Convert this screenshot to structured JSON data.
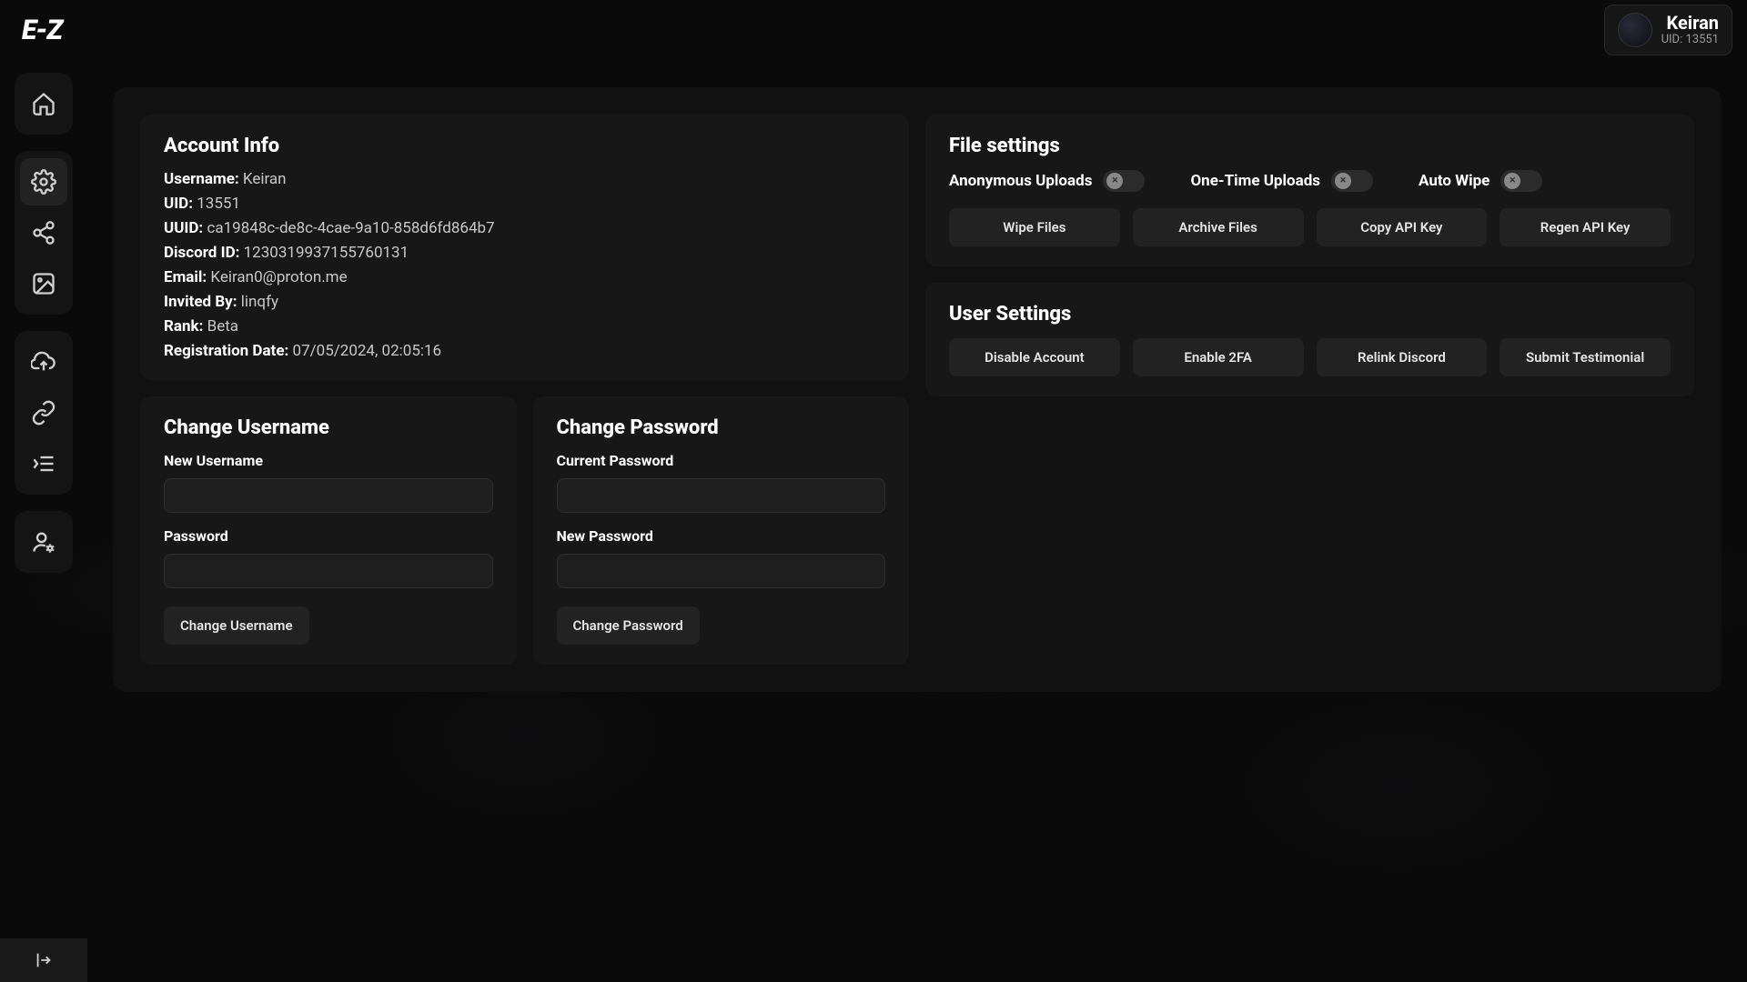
{
  "header": {
    "logo_text": "E-Z",
    "user_name": "Keiran",
    "user_uid_prefix": "UID: ",
    "user_uid": "13551"
  },
  "sidebar": {
    "items": [
      {
        "name": "home",
        "icon": "home"
      },
      {
        "name": "settings",
        "icon": "gear"
      },
      {
        "name": "share",
        "icon": "share"
      },
      {
        "name": "image",
        "icon": "image"
      },
      {
        "name": "upload",
        "icon": "cloud-upload"
      },
      {
        "name": "link",
        "icon": "link"
      },
      {
        "name": "list",
        "icon": "list-indent"
      },
      {
        "name": "user-settings",
        "icon": "user-gear"
      }
    ],
    "expand_label": "Expand"
  },
  "account_info": {
    "title": "Account Info",
    "fields": {
      "username_label": "Username:",
      "username_value": "Keiran",
      "uid_label": "UID:",
      "uid_value": "13551",
      "uuid_label": "UUID:",
      "uuid_value": "ca19848c-de8c-4cae-9a10-858d6fd864b7",
      "discord_label": "Discord ID:",
      "discord_value": "1230319937155760131",
      "email_label": "Email:",
      "email_value": "Keiran0@proton.me",
      "invited_label": "Invited By:",
      "invited_value": "linqfy",
      "rank_label": "Rank:",
      "rank_value": "Beta",
      "regdate_label": "Registration Date:",
      "regdate_value": "07/05/2024, 02:05:16"
    }
  },
  "file_settings": {
    "title": "File settings",
    "toggles": {
      "anon": "Anonymous Uploads",
      "onetime": "One-Time Uploads",
      "autowipe": "Auto Wipe"
    },
    "buttons": {
      "wipe": "Wipe Files",
      "archive": "Archive Files",
      "copy_api": "Copy API Key",
      "regen_api": "Regen API Key"
    }
  },
  "user_settings": {
    "title": "User Settings",
    "buttons": {
      "disable": "Disable Account",
      "enable2fa": "Enable 2FA",
      "relink": "Relink Discord",
      "testimonial": "Submit Testimonial"
    }
  },
  "change_username": {
    "title": "Change Username",
    "new_username_label": "New Username",
    "password_label": "Password",
    "submit": "Change Username"
  },
  "change_password": {
    "title": "Change Password",
    "current_label": "Current Password",
    "new_label": "New Password",
    "submit": "Change Password"
  }
}
